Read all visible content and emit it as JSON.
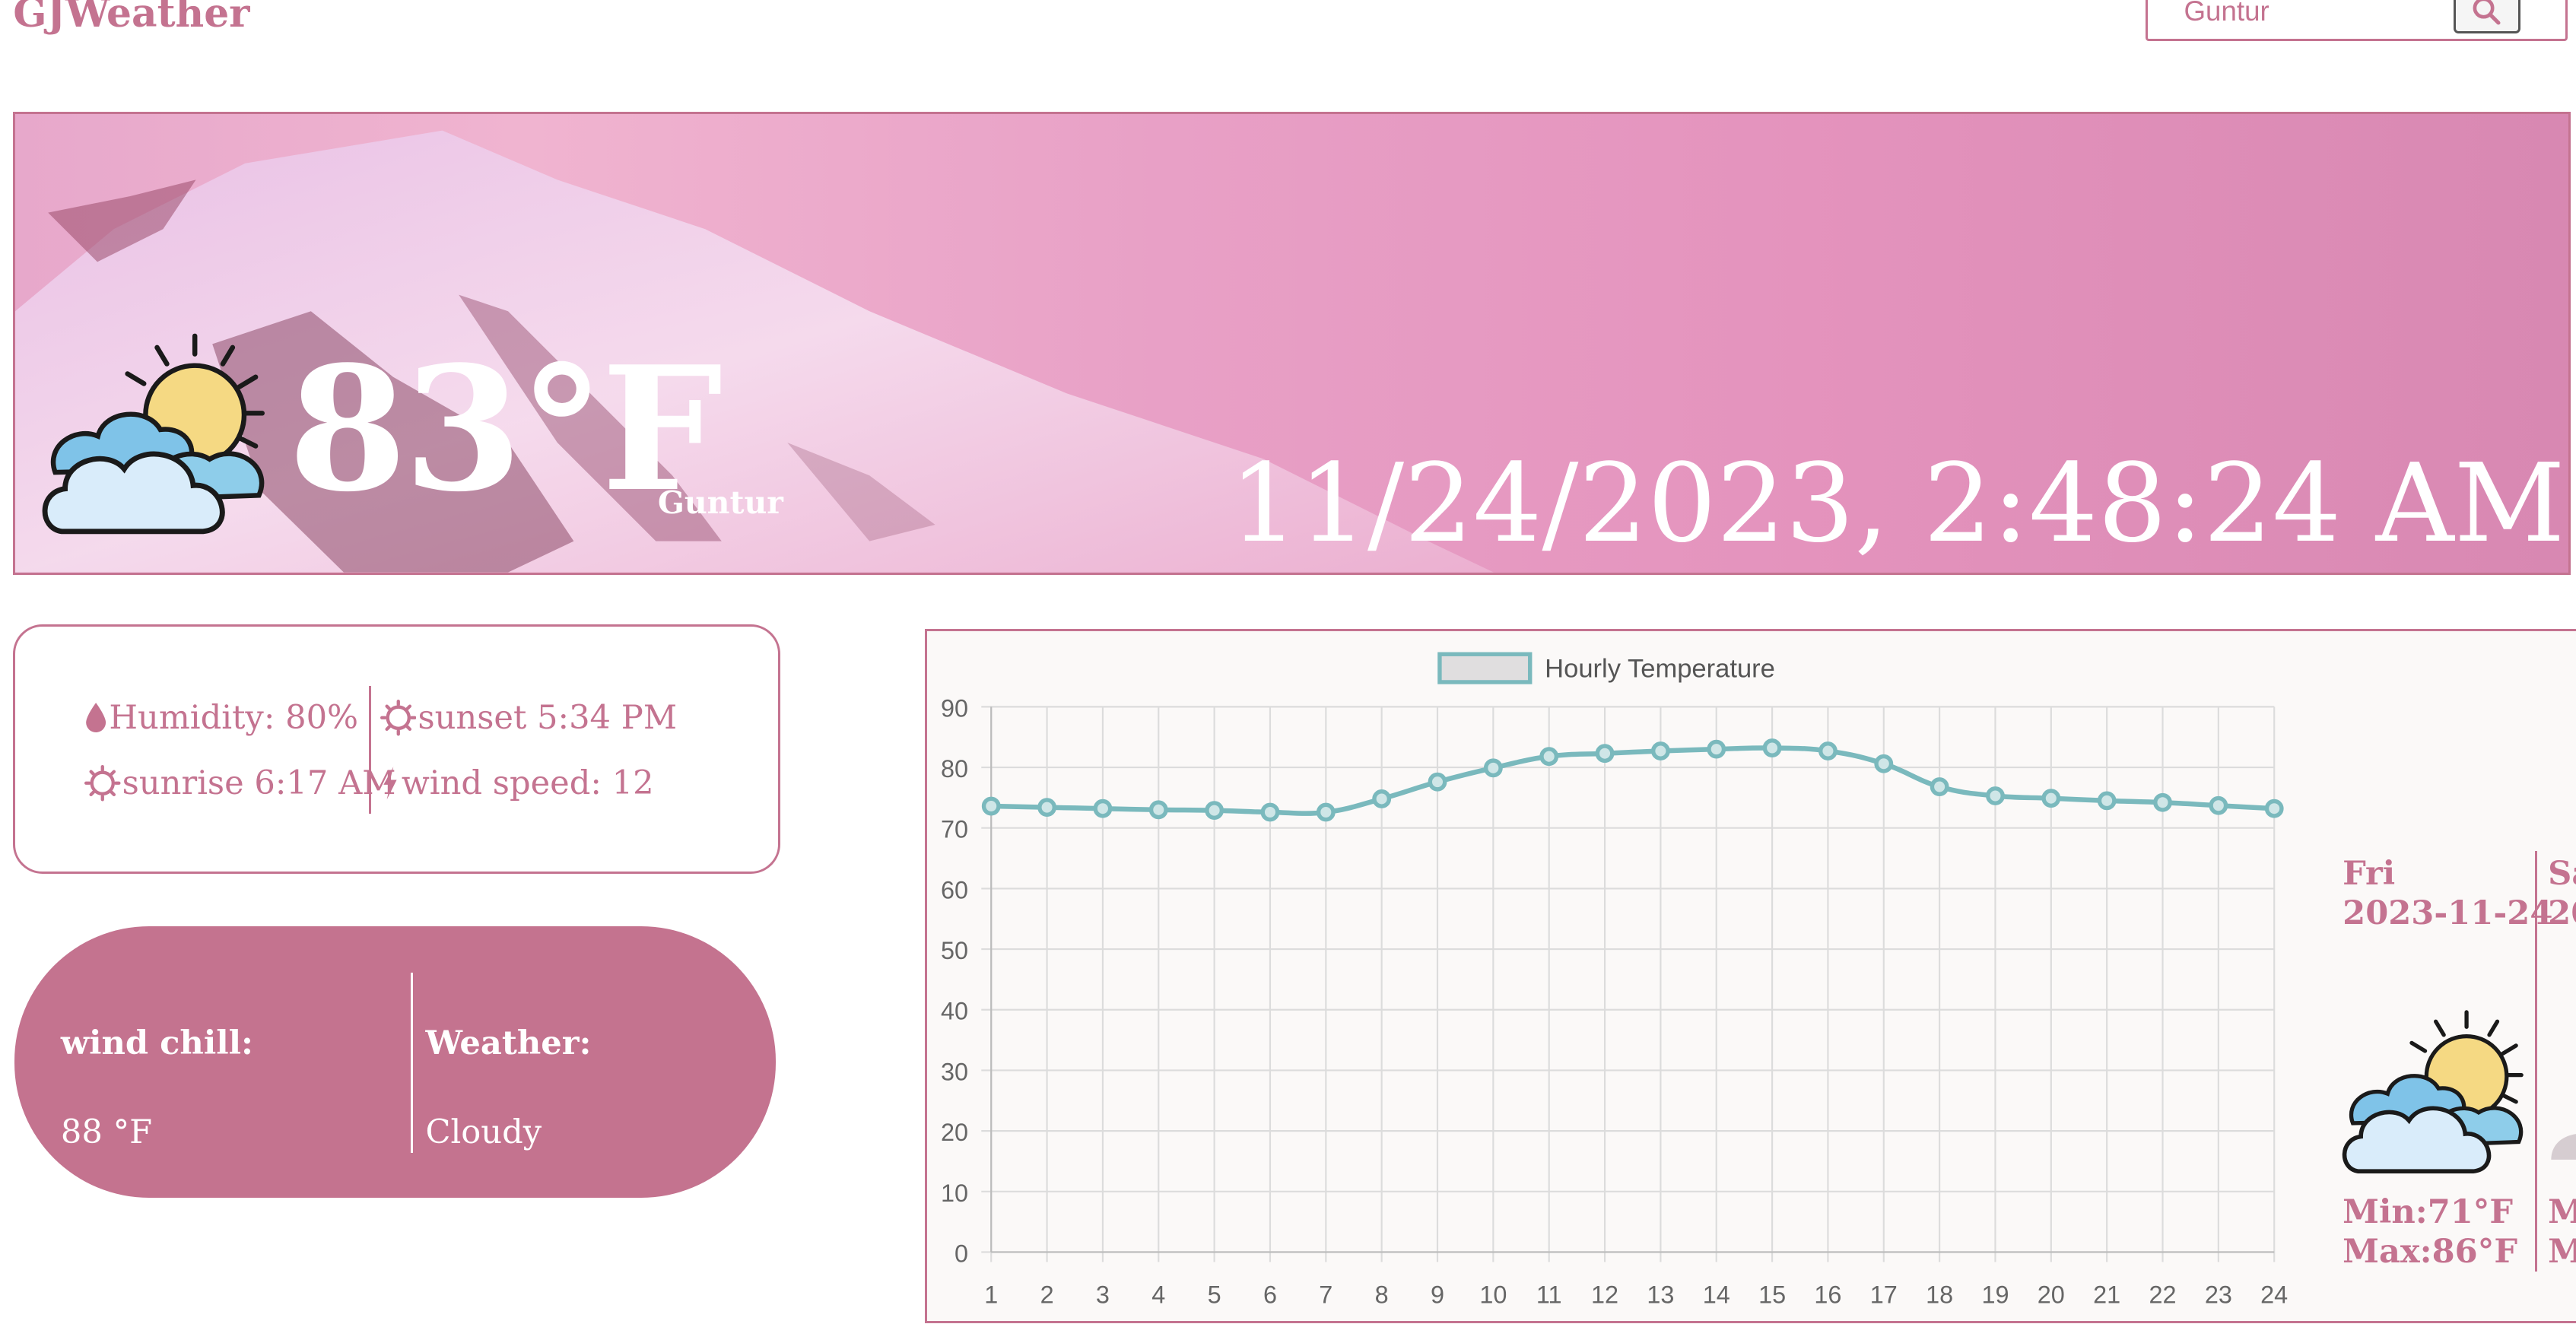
{
  "header": {
    "brand": "GJWeather",
    "search": {
      "value": "Guntur",
      "placeholder": ""
    }
  },
  "current": {
    "temperature": "83°F",
    "city": "Guntur",
    "datetime": "11/24/2023, 2:48:24 AM",
    "icon": "partly-cloudy-icon"
  },
  "stats": {
    "humidity": "Humidity: 80%",
    "sunrise": "sunrise 6:17 AM",
    "sunset": "sunset 5:34 PM",
    "wind_speed": "wind speed: 12"
  },
  "conditions": {
    "wind_chill_label": "wind chill:",
    "wind_chill_value": "88 °F",
    "weather_label": "Weather:",
    "weather_value": "Cloudy"
  },
  "chart_data": {
    "type": "line",
    "x": [
      1,
      2,
      3,
      4,
      5,
      6,
      7,
      8,
      9,
      10,
      11,
      12,
      13,
      14,
      15,
      16,
      17,
      18,
      19,
      20,
      21,
      22,
      23,
      24
    ],
    "series": [
      {
        "name": "Hourly Temperature",
        "values": [
          73.6,
          73.4,
          73.2,
          73.0,
          72.9,
          72.6,
          72.6,
          74.8,
          77.6,
          79.9,
          81.8,
          82.3,
          82.7,
          83.0,
          83.2,
          82.7,
          80.6,
          76.8,
          75.3,
          74.9,
          74.5,
          74.2,
          73.7,
          73.2
        ]
      }
    ],
    "ylim": [
      0,
      90
    ],
    "yticks": [
      0,
      10,
      20,
      30,
      40,
      50,
      60,
      70,
      80,
      90
    ],
    "grid": true,
    "legend": "top-center",
    "colors": {
      "line": "#7ab9bd",
      "legend_fill": "#e0dedf"
    }
  },
  "forecast": [
    {
      "day": "Fri",
      "date": "2023-11-24",
      "min": "Min:71°F",
      "max": "Max:86°F",
      "icon": "partly-cloudy-icon"
    },
    {
      "day": "Sa",
      "date": "20",
      "min": "M",
      "max": "M",
      "icon": "partial-icon"
    }
  ],
  "colors": {
    "accent": "#c47390",
    "card_fill": "#c4738f",
    "hero_text": "#ffffff"
  }
}
